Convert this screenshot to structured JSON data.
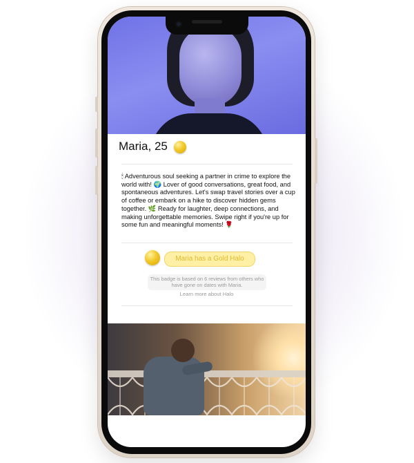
{
  "profile": {
    "name_age": "Maria, 25",
    "bio": "🕯 Adventurous soul seeking a partner in crime to explore the world with! 🌍 Lover of good conversations, great food, and spontaneous adventures. Let's swap travel stories over a cup of coffee or embark on a hike to discover hidden gems together. 🌿 Ready for laughter, deep connections, and making unforgettable memories. Swipe right if you're up for some fun and meaningful moments! 🌹"
  },
  "halo": {
    "label": "Maria has a Gold Halo",
    "note": "This badge is based on 6 reviews from others who have gone on dates with Maria.",
    "learn_more": "Learn more about Halo"
  },
  "icons": {
    "badge": "gold-halo-icon",
    "camera": "front-camera-icon"
  },
  "colors": {
    "halo_gold": "#f2c82b",
    "halo_pill_bg": "#fff0a6",
    "halo_text": "#e0b92c",
    "hero_bg": "#6f72e6"
  }
}
